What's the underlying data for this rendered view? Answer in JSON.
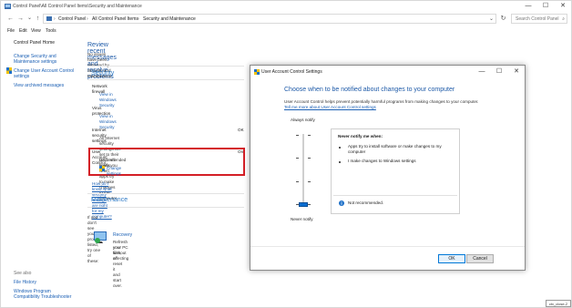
{
  "window": {
    "title": "Control Panel\\All Control Panel Items\\Security and Maintenance",
    "minimize": "—",
    "maximize": "☐",
    "close": "✕"
  },
  "address": {
    "back": "←",
    "forward": "→",
    "recent": "⌄",
    "up": "↑",
    "crumbs": [
      "Control Panel",
      "All Control Panel Items",
      "Security and Maintenance"
    ],
    "separator": "›",
    "dropdown": "⌄",
    "refresh": "↻",
    "search_placeholder": "Search Control Panel",
    "search_icon": "⌕"
  },
  "menu": [
    "File",
    "Edit",
    "View",
    "Tools"
  ],
  "sidebar": {
    "items": [
      "Control Panel Home",
      "Change Security and",
      "Maintenance settings",
      "Change User Account Control",
      "settings",
      "View archived messages"
    ],
    "see_also_heading": "See also",
    "see_also": [
      "File History",
      "Windows Program",
      "Compatibility Troubleshooter"
    ]
  },
  "main": {
    "heading": "Review recent messages and resolve problems",
    "no_issues": "No issues have been detected by Security and Maintenance.",
    "security_heading": "Security",
    "network_firewall": "Network firewall",
    "view_ws_1": "View in Windows Security",
    "virus_protection": "Virus protection",
    "view_ws_2": "View in Windows Security",
    "internet_security": "Internet security settings",
    "internet_status": "OK",
    "internet_desc": "All Internet security settings are set to their recommended levels.",
    "uac_title": "User Account Control",
    "uac_status": "On",
    "uac_desc": "UAC will notify you when apps try to make changes to the computer.",
    "change_settings": "Change settings",
    "how_link": "How do I know what security settings are right for my computer?",
    "maintenance_heading": "Maintenance",
    "problem_text": "If you don't see your problem listed, try one of these:",
    "recovery_title": "Recovery",
    "recovery_desc_1": "Refresh your PC without affecting",
    "recovery_desc_2": "your files, or reset it and start over."
  },
  "dialog": {
    "title": "User Account Control Settings",
    "heading": "Choose when to be notified about changes to your computer",
    "desc": "User Account Control helps prevent potentially harmful programs from making changes to your computer.",
    "link": "Tell me more about User Account Control settings",
    "always_notify": "Always notify",
    "never_notify": "Never notify",
    "panel_title": "Never notify me when:",
    "bullet_1_line1": "Apps try to install software or make changes to my",
    "bullet_1_line2": "computer",
    "bullet_2": "I make changes to Windows settings",
    "info_text": "Not recommended.",
    "ok": "OK",
    "cancel": "Cancel",
    "level": "never-notify"
  },
  "corner_label": "ctx_close-2"
}
